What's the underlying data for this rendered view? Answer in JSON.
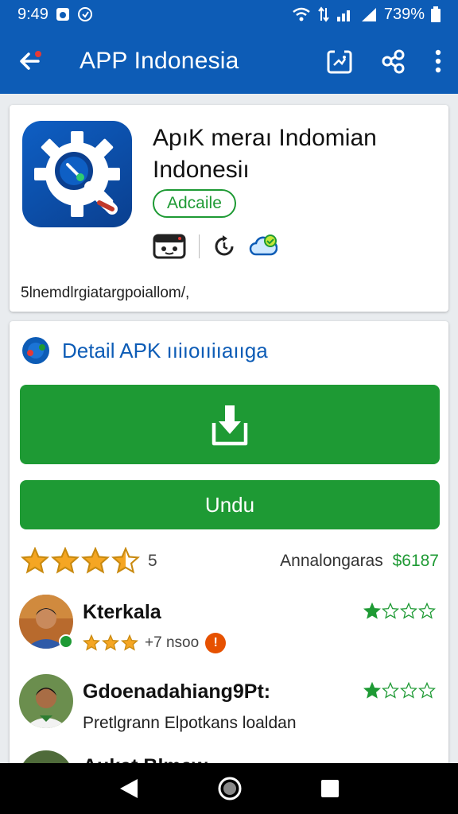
{
  "status": {
    "time": "9:49",
    "battery": "739%"
  },
  "appbar": {
    "title": "APP Indonesia"
  },
  "app": {
    "title": "ApıK meraı Indomian Indonesiı",
    "badge": "Adcaile",
    "summary": "5lnemdlrgiatargpoiallom/,"
  },
  "detail": {
    "title": "Detail APK ııiıoııiıaııga",
    "download_label": "",
    "undu_label": "Undu"
  },
  "rating": {
    "stars": 3.5,
    "count": "5",
    "right_label": "Annalongaras",
    "right_value": "$6187"
  },
  "reviews": [
    {
      "name": "Kterkala",
      "meta": "+7 nsoo",
      "stars": 3,
      "right_stars": 1
    },
    {
      "name": "Gdoenadahiang9Pt:",
      "text": "Pretlgrann Elpotkans loaldan",
      "right_stars": 1
    },
    {
      "name": "Aukat Blmaw"
    }
  ],
  "colors": {
    "primary": "#0d5cb6",
    "green": "#1e9a34",
    "star": "#f5a623"
  }
}
